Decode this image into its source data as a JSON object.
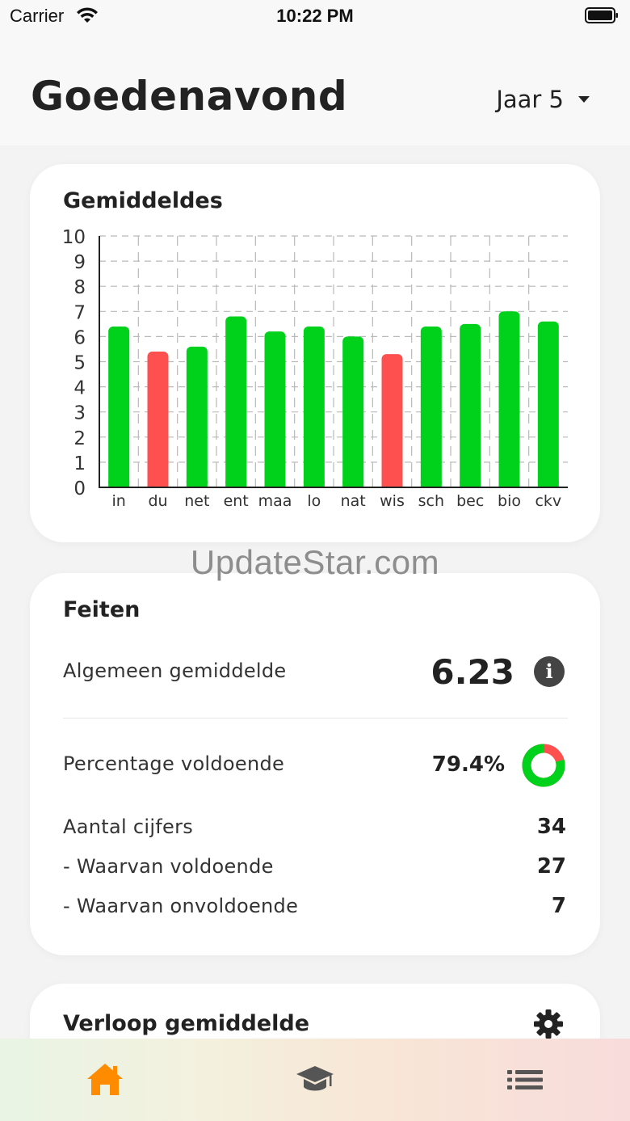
{
  "status_bar": {
    "carrier": "Carrier",
    "time": "10:22 PM"
  },
  "header": {
    "greeting": "Goedenavond",
    "year_selector": "Jaar 5"
  },
  "averages_card": {
    "title": "Gemiddeldes"
  },
  "chart_data": {
    "type": "bar",
    "title": "Gemiddeldes",
    "categories": [
      "in",
      "du",
      "net",
      "ent",
      "maa",
      "lo",
      "nat",
      "wis",
      "sch",
      "bec",
      "bio",
      "ckv"
    ],
    "values": [
      6.4,
      5.4,
      5.6,
      6.8,
      6.2,
      6.4,
      6.0,
      5.3,
      6.4,
      6.5,
      7.0,
      6.6
    ],
    "ylim": [
      0,
      10
    ],
    "yticks": [
      "0",
      "1",
      "2",
      "3",
      "4",
      "5",
      "6",
      "7",
      "8",
      "9",
      "10"
    ],
    "pass_threshold": 5.5,
    "colors": {
      "pass": "#00d21c",
      "fail": "#ff5050"
    },
    "grid": true
  },
  "watermark": "UpdateStar.com",
  "facts_card": {
    "title": "Feiten",
    "overall_average_label": "Algemeen gemiddelde",
    "overall_average_value": "6.23",
    "pass_percentage_label": "Percentage voldoende",
    "pass_percentage_value": "79.4%",
    "pass_fraction": 0.794,
    "grade_count_label": "Aantal cijfers",
    "grade_count_value": "34",
    "passing_label": "- Waarvan voldoende",
    "passing_value": "27",
    "failing_label": "- Waarvan onvoldoende",
    "failing_value": "7"
  },
  "trend_card": {
    "title": "Verloop gemiddelde"
  },
  "tab_bar": {
    "active_color": "#ff8c00",
    "inactive_color": "#555555",
    "items": [
      {
        "icon": "home-icon",
        "active": true
      },
      {
        "icon": "graduation-cap-icon",
        "active": false
      },
      {
        "icon": "list-icon",
        "active": false
      }
    ]
  }
}
